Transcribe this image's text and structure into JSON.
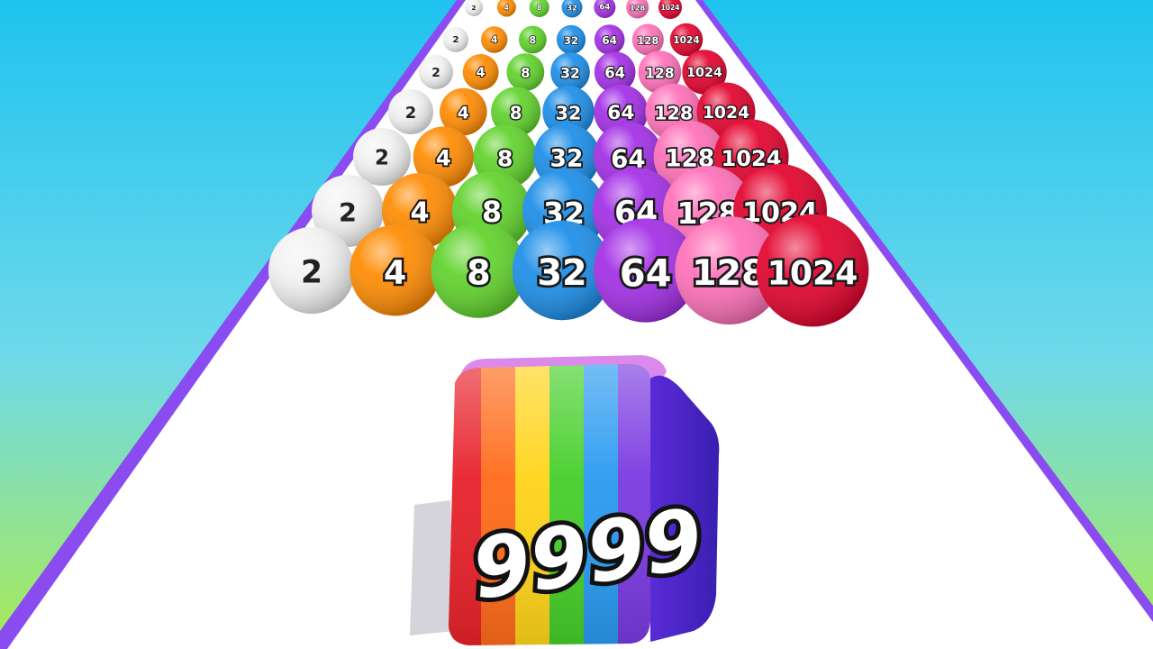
{
  "game": {
    "ball_values": [
      "2",
      "4",
      "8",
      "32",
      "64",
      "128",
      "1024"
    ],
    "ball_colors": [
      "#f2f2f2",
      "#ff8a00",
      "#5fd22a",
      "#1a8de8",
      "#a22de6",
      "#ff6fb8",
      "#e3002b"
    ],
    "dark_label_values": [
      "2"
    ],
    "cube_value": "9999",
    "cube_stripe_colors": [
      "#e8222b",
      "#ff6b1a",
      "#ffd41a",
      "#46cf2a",
      "#2a9af0",
      "#7a3ae0"
    ],
    "sky_top": "#1fc3ef",
    "sky_bottom": "#a9ea55",
    "track_color": "#ffffff",
    "track_edge_color": "#8a4bf0"
  }
}
